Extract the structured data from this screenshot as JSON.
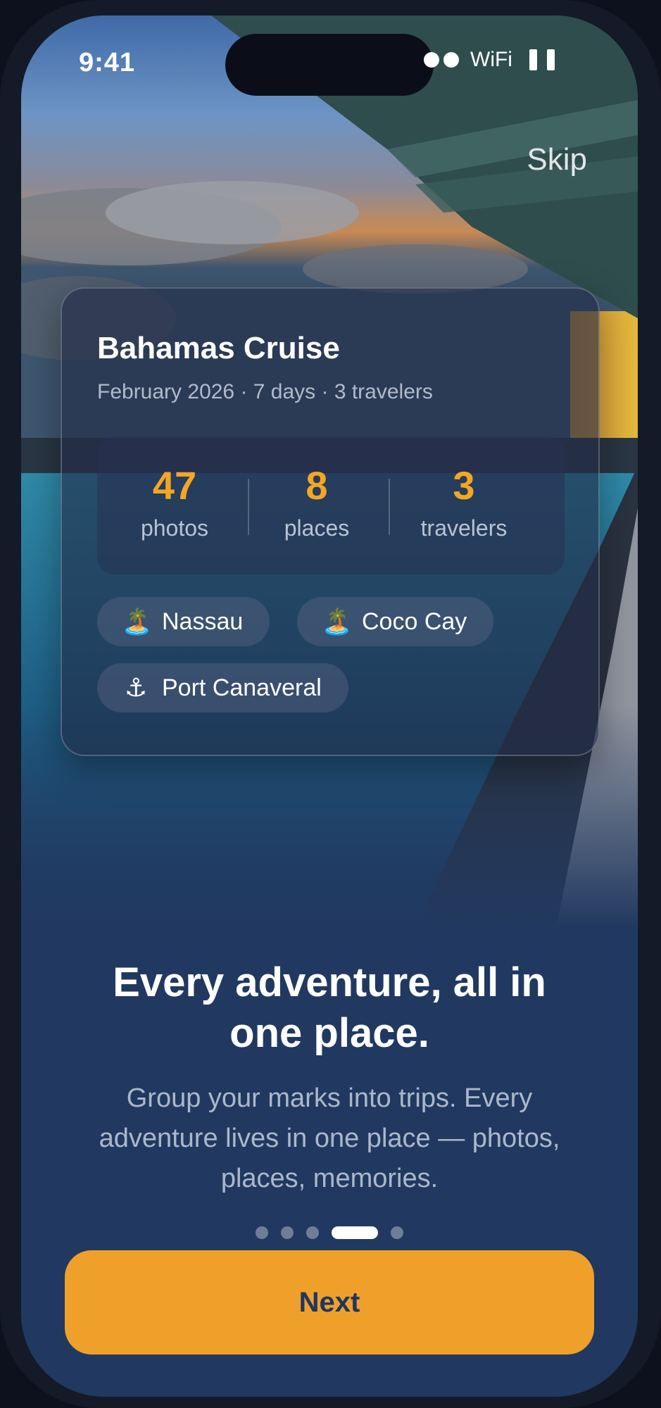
{
  "status_bar": {
    "time": "9:41",
    "network": "WiFi"
  },
  "top_nav": {
    "skip_label": "Skip"
  },
  "trip_card": {
    "title": "Bahamas Cruise",
    "subtitle": "February 2026 · 7 days · 3 travelers",
    "stats": [
      {
        "value": "47",
        "label": "photos"
      },
      {
        "value": "8",
        "label": "places"
      },
      {
        "value": "3",
        "label": "travelers"
      }
    ],
    "places": [
      {
        "icon": "🏝️",
        "icon_name": "island-icon",
        "label": "Nassau"
      },
      {
        "icon": "🏝️",
        "icon_name": "island-icon",
        "label": "Coco Cay"
      },
      {
        "icon": "⚓",
        "icon_name": "anchor-icon",
        "label": "Port Canaveral"
      }
    ]
  },
  "onboarding": {
    "headline_line1": "Every adventure, all in",
    "headline_line2": "one place.",
    "body_line1": "Group your marks into trips. Every",
    "body_line2": "adventure lives in one place — photos,",
    "body_line3": "places, memories.",
    "page_count": 5,
    "active_page": 4,
    "next_label": "Next"
  },
  "colors": {
    "accent": "#efa02b",
    "stat_value": "#f5a623",
    "panel_background": "#213960",
    "button_text": "#1f3660"
  }
}
